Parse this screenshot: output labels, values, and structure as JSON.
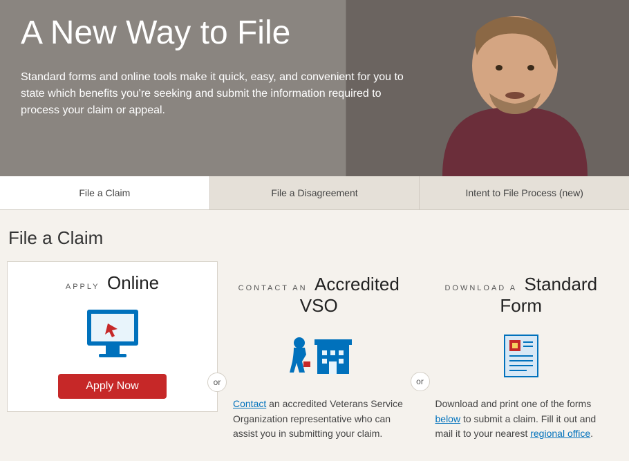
{
  "hero": {
    "title": "A New Way to File",
    "subtitle": "Standard forms and online tools make it quick, easy, and convenient for you to state which benefits you're seeking and submit the information required to process your claim or appeal."
  },
  "tabs": [
    {
      "label": "File a Claim",
      "active": true
    },
    {
      "label": "File a Disagreement",
      "active": false
    },
    {
      "label": "Intent to File Process (new)",
      "active": false
    }
  ],
  "section_heading": "File a Claim",
  "or_label": "or",
  "cards": {
    "online": {
      "prefix": "APPLY",
      "main": "Online",
      "button": "Apply Now"
    },
    "vso": {
      "prefix": "CONTACT AN",
      "main": "Accredited VSO",
      "link_text": "Contact",
      "desc_after": " an accredited Veterans Service Organization representative who can assist you in submitting your claim."
    },
    "form": {
      "prefix": "DOWNLOAD A",
      "main": "Standard Form",
      "desc_before": "Download and print one of the forms ",
      "link1": "below",
      "desc_mid": " to submit a claim. Fill it out and mail it to your nearest ",
      "link2": "regional office",
      "desc_after": "."
    }
  }
}
